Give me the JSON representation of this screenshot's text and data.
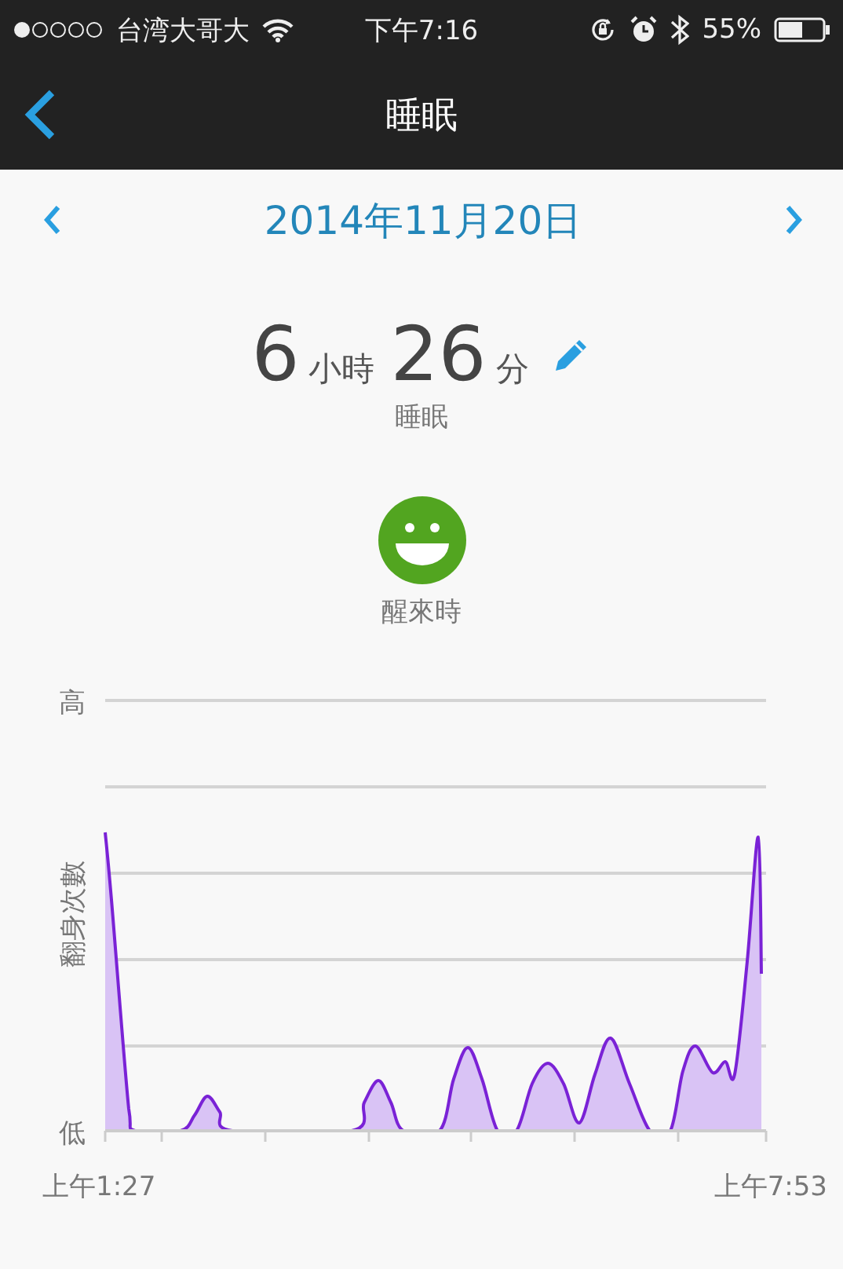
{
  "status_bar": {
    "carrier": "台湾大哥大",
    "time": "下午7:16",
    "battery": "55%"
  },
  "nav": {
    "title": "睡眠"
  },
  "date_nav": {
    "date": "2014年11月20日"
  },
  "summary": {
    "hours": "6",
    "hours_unit": "小時",
    "minutes": "26",
    "minutes_unit": "分",
    "label": "睡眠"
  },
  "mood": {
    "label": "醒來時"
  },
  "chart": {
    "y_label": "翻身次數",
    "y_high": "高",
    "y_low": "低",
    "x_start": "上午1:27",
    "x_end": "上午7:53"
  }
}
